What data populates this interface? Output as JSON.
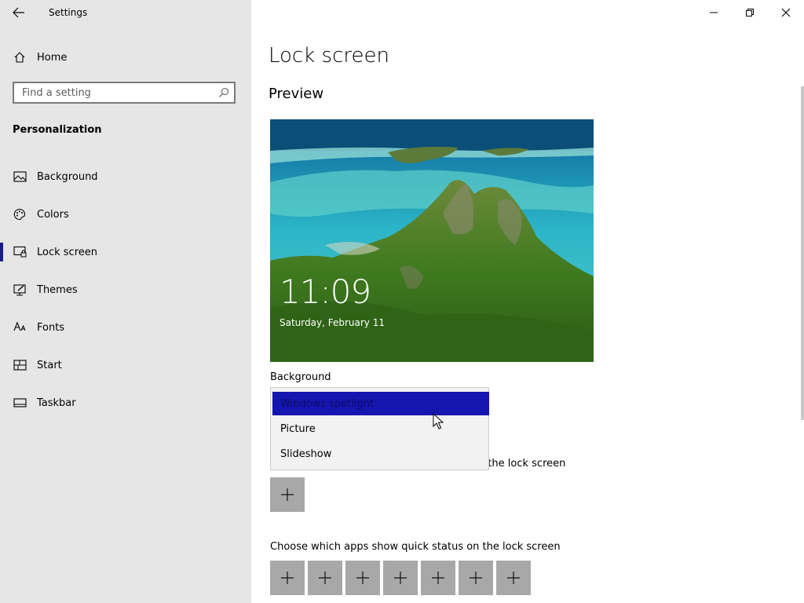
{
  "window": {
    "title": "Settings"
  },
  "sidebar": {
    "home_label": "Home",
    "search_placeholder": "Find a setting",
    "section_title": "Personalization",
    "items": [
      {
        "label": "Background",
        "icon": "picture-icon"
      },
      {
        "label": "Colors",
        "icon": "palette-icon"
      },
      {
        "label": "Lock screen",
        "icon": "lock-screen-icon",
        "active": true
      },
      {
        "label": "Themes",
        "icon": "themes-icon"
      },
      {
        "label": "Fonts",
        "icon": "fonts-icon"
      },
      {
        "label": "Start",
        "icon": "start-icon"
      },
      {
        "label": "Taskbar",
        "icon": "taskbar-icon"
      }
    ]
  },
  "main": {
    "title": "Lock screen",
    "preview_title": "Preview",
    "preview": {
      "time": "11:09",
      "date": "Saturday, February 11"
    },
    "background_label": "Background",
    "background_dropdown": {
      "options": [
        "Windows spotlight",
        "Picture",
        "Slideshow"
      ],
      "selected": "Windows spotlight"
    },
    "detailed_status_label": "Choose an app to show detailed status on the lock screen",
    "quick_status_label": "Choose which apps show quick status on the lock screen",
    "quick_status_slots": 7
  },
  "colors": {
    "sidebar_bg": "#e6e6e6",
    "selection": "#1515b0",
    "tile": "#a8a8a8",
    "accent": "#1a1a8c"
  }
}
